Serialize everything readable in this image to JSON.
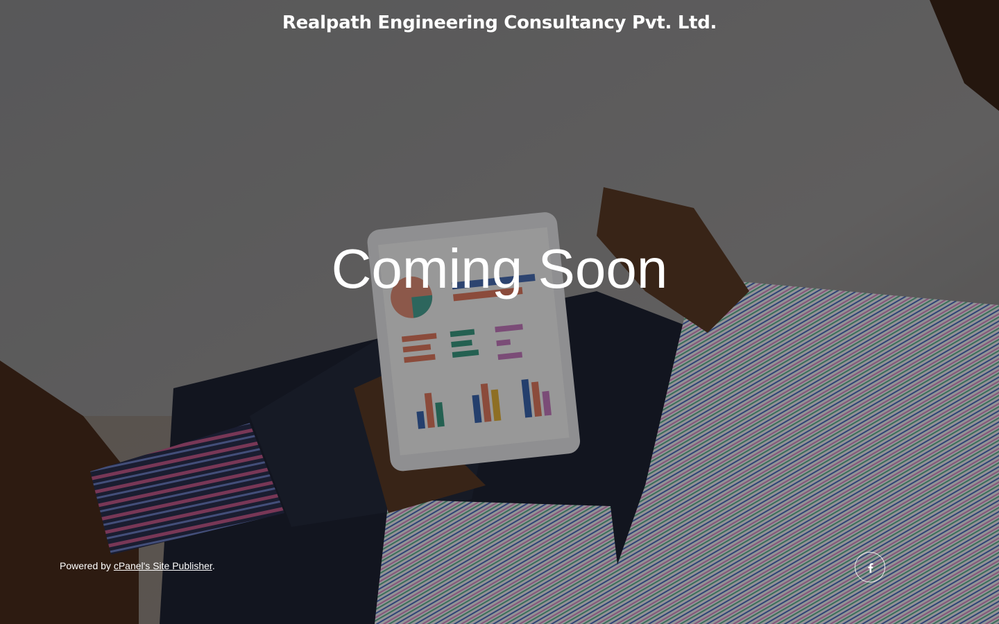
{
  "header": {
    "site_title": "Realpath Engineering Consultancy Pvt. Ltd."
  },
  "main": {
    "headline": "Coming Soon"
  },
  "footer": {
    "powered_by_prefix": "Powered by ",
    "powered_by_link": "cPanel's Site Publisher",
    "powered_by_suffix": "."
  },
  "social": {
    "facebook_icon": "facebook-icon"
  },
  "colors": {
    "text": "#ffffff",
    "overlay": "#000000"
  }
}
